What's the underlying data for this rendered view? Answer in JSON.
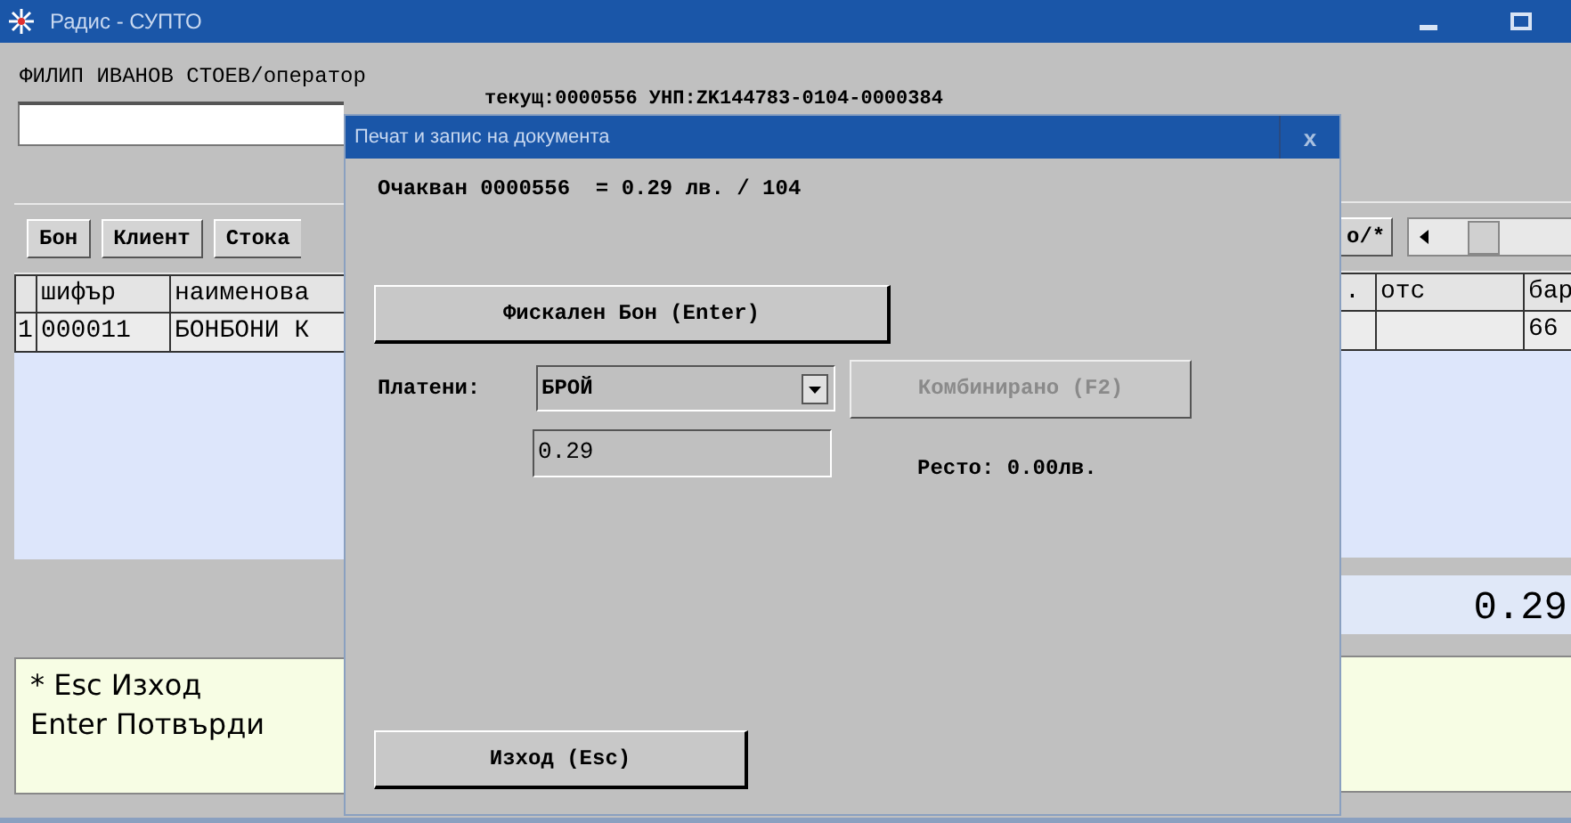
{
  "window": {
    "title": "Радис - СУПТО"
  },
  "operator": "ФИЛИП ИВАНОВ СТОЕВ/оператор",
  "current_doc": "текущ:0000556 УНП:ZK144783-0104-0000384",
  "toolbar_left": [
    "Бон",
    "Клиент",
    "Стока"
  ],
  "toolbar_right": [
    "о/*"
  ],
  "table": {
    "columns": [
      "шифър",
      "наименова",
      ".",
      "отс",
      "бар"
    ],
    "rows": [
      {
        "number": "1",
        "cells": [
          "000011",
          "БОНБОНИ К",
          "",
          "",
          "66"
        ]
      }
    ]
  },
  "total": "0.29",
  "help": [
    "* Esc Изход",
    "Enter Потвърди"
  ],
  "dialog": {
    "title": "Печат и запис на документа",
    "close": "x",
    "expected": "Очакван 0000556  = 0.29 лв. / 104",
    "fiscal_button": "Фискален Бон (Enter)",
    "paid_label": "Платени:",
    "payment": "БРОЙ",
    "combined_button": {
      "label": "Комбинирано (F2)",
      "disabled": true
    },
    "amount": "0.29",
    "change": "Ресто: 0.00лв.",
    "exit_button": "Изход (Esc)"
  }
}
